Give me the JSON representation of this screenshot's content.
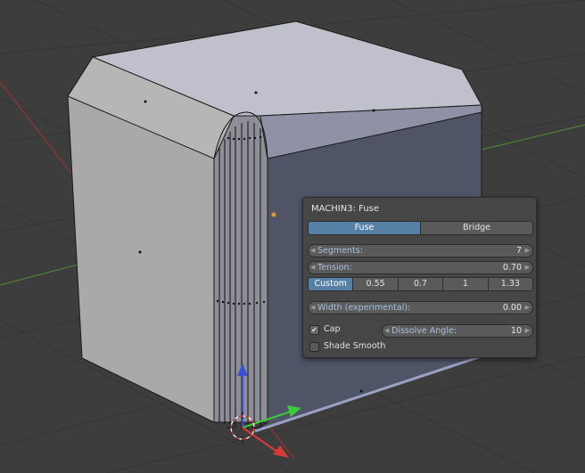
{
  "panel": {
    "title": "MACHIN3: Fuse",
    "modes": [
      {
        "label": "Fuse",
        "active": true
      },
      {
        "label": "Bridge",
        "active": false
      }
    ],
    "segments": {
      "label": "Segments:",
      "value": "7"
    },
    "tension": {
      "label": "Tension:",
      "value": "0.70"
    },
    "tension_presets": [
      {
        "label": "Custom",
        "active": true
      },
      {
        "label": "0.55",
        "active": false
      },
      {
        "label": "0.7",
        "active": false
      },
      {
        "label": "1",
        "active": false
      },
      {
        "label": "1.33",
        "active": false
      }
    ],
    "width": {
      "label": "Width (experimental):",
      "value": "0.00"
    },
    "cap": {
      "label": "Cap",
      "checked": true
    },
    "dissolve_angle": {
      "label": "Dissolve Angle:",
      "value": "10"
    },
    "shade_smooth": {
      "label": "Shade Smooth",
      "checked": false
    }
  },
  "colors": {
    "background": "#3d3d3d",
    "accent": "#5680a5",
    "axis_x": "#d33a3a",
    "axis_y": "#5fa83a"
  },
  "icons": {
    "cursor": "3d-cursor-icon",
    "gizmo": "transform-gizmo-icon"
  }
}
